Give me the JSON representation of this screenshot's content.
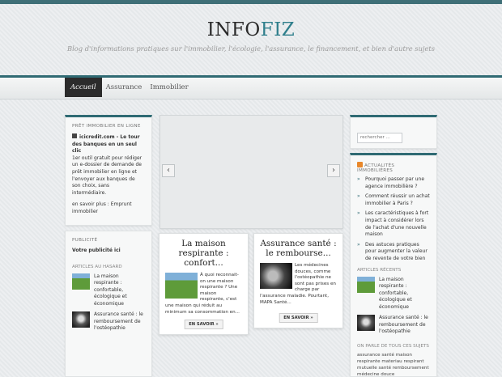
{
  "header": {
    "title_main": "INFO",
    "title_accent": "FIZ",
    "tagline": "Blog d'informations pratiques sur l'immobilier, l'écologie, l'assurance, le financement, et bien d'autre sujets"
  },
  "nav": {
    "items": [
      "Accueil",
      "Assurance",
      "Immobilier"
    ]
  },
  "pret": {
    "title": "PRÊT IMMOBILIER EN LIGNE",
    "link": "icicredit.com - Le tour des banques en un seul clic",
    "body": "1er outil gratuit pour rédiger un e-dossier de demande de prêt immobilier en ligne et l'envoyer aux banques de son choix, sans intermédiaire.",
    "more": "en savoir plus : Emprunt immobilier"
  },
  "pub": {
    "title": "PUBLICITÉ",
    "text": "Votre publicité ici"
  },
  "random": {
    "title": "ARTICLES AU HASARD",
    "items": [
      "La maison respirante : confortable, écologique et économique",
      "Assurance santé : le remboursement de l'ostéopathie"
    ]
  },
  "posts": [
    {
      "title": "La maison respirante : confort...",
      "body": "À quoi reconnait-on une maison respirante ? Une maison respirante, c'est une maison qui réduit au minimum sa consommation en...",
      "button": "EN SAVOIR »"
    },
    {
      "title": "Assurance santé : le rembourse...",
      "body": "Les médecines douces, comme l'ostéopathie ne sont pas prises en charge par l'assurance maladie. Pourtant, MAPA Santé...",
      "button": "EN SAVOIR »"
    }
  ],
  "search": {
    "placeholder": "rechercher ..."
  },
  "news": {
    "title": "ACTUALITÉS IMMOBILIÈRES",
    "items": [
      "Pourquoi passer par une agence immobilière ?",
      "Comment réussir un achat immobilier à Paris ?",
      "Les caractéristiques à fort impact à considérer lors de l'achat d'une nouvelle maison",
      "Des astuces pratiques pour augmenter la valeur de revente de votre bien"
    ]
  },
  "recent": {
    "title": "ARTICLES RÉCENTS",
    "items": [
      "La maison respirante : confortable, écologique et économique",
      "Assurance santé : le remboursement de l'ostéopathie"
    ]
  },
  "tags": {
    "title": "ON PARLE DE TOUS CES SUJETS",
    "text": "assurance santé maison respirante materiau respirant mutuelle santé remboursement médecine douce remboursement ostéopathie"
  },
  "colors": {
    "accent": "#2f6a73",
    "title_accent": "#2f7f8c",
    "nav_active": "#2b2b2b"
  }
}
